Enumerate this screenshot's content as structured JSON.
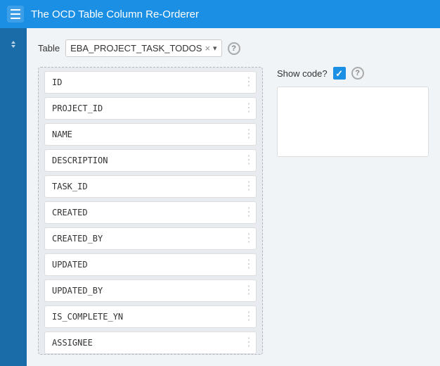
{
  "header": {
    "title": "The OCD Table Column Re-Orderer",
    "menu_label": "Menu"
  },
  "table_selector": {
    "label": "Table",
    "selected_value": "EBA_PROJECT_TASK_TODOS",
    "clear_label": "×",
    "arrow_label": "▾",
    "help_label": "?"
  },
  "columns": [
    {
      "name": "ID"
    },
    {
      "name": "PROJECT_ID"
    },
    {
      "name": "NAME"
    },
    {
      "name": "DESCRIPTION"
    },
    {
      "name": "TASK_ID"
    },
    {
      "name": "CREATED"
    },
    {
      "name": "CREATED_BY"
    },
    {
      "name": "UPDATED"
    },
    {
      "name": "UPDATED_BY"
    },
    {
      "name": "IS_COMPLETE_YN"
    },
    {
      "name": "ASSIGNEE"
    }
  ],
  "right_panel": {
    "show_code_label": "Show code?",
    "help_label": "?",
    "checkbox_checked": true
  }
}
